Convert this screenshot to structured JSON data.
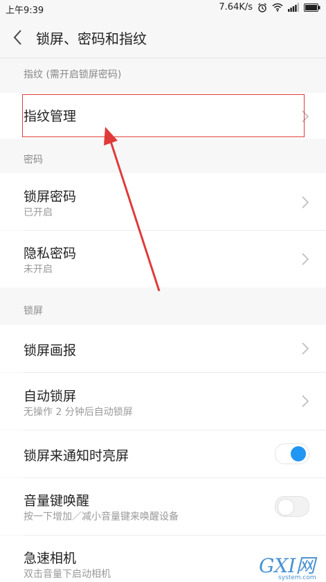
{
  "status_bar": {
    "time": "上午9:39",
    "speed": "7.64K/s"
  },
  "header": {
    "title": "锁屏、密码和指纹"
  },
  "sections": {
    "fingerprint": {
      "header": "指纹 (需开启锁屏密码)",
      "item": "指纹管理"
    },
    "password": {
      "header": "密码",
      "lock_password": {
        "title": "锁屏密码",
        "subtitle": "已开启"
      },
      "privacy_password": {
        "title": "隐私密码",
        "subtitle": "未开启"
      }
    },
    "lockscreen": {
      "header": "锁屏",
      "wallpaper": {
        "title": "锁屏画报"
      },
      "auto_lock": {
        "title": "自动锁屏",
        "subtitle": "无操作 2 分钟后自动锁屏"
      },
      "notify_wake": {
        "title": "锁屏来通知时亮屏",
        "enabled": true
      },
      "volume_wake": {
        "title": "音量键唤醒",
        "subtitle": "按一下增加／减小音量键来唤醒设备",
        "enabled": false
      },
      "quick_camera": {
        "title": "急速相机",
        "subtitle": "双击音量下启动相机"
      }
    }
  },
  "watermark": {
    "text": "GXI网",
    "sub": "system.com"
  },
  "colors": {
    "accent": "#2196f3",
    "annotation": "#e03a3a"
  }
}
